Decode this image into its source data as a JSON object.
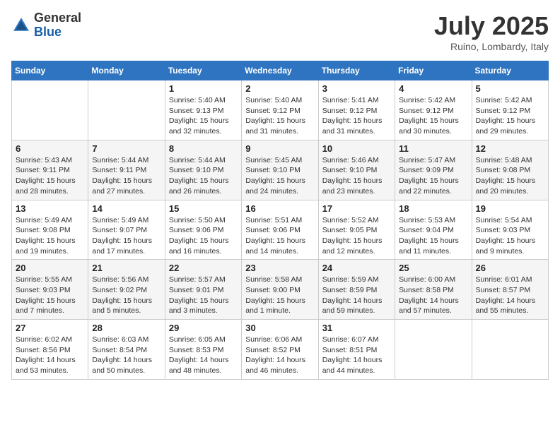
{
  "header": {
    "logo_general": "General",
    "logo_blue": "Blue",
    "month_title": "July 2025",
    "location": "Ruino, Lombardy, Italy"
  },
  "weekdays": [
    "Sunday",
    "Monday",
    "Tuesday",
    "Wednesday",
    "Thursday",
    "Friday",
    "Saturday"
  ],
  "weeks": [
    [
      {
        "day": "",
        "detail": ""
      },
      {
        "day": "",
        "detail": ""
      },
      {
        "day": "1",
        "detail": "Sunrise: 5:40 AM\nSunset: 9:13 PM\nDaylight: 15 hours\nand 32 minutes."
      },
      {
        "day": "2",
        "detail": "Sunrise: 5:40 AM\nSunset: 9:12 PM\nDaylight: 15 hours\nand 31 minutes."
      },
      {
        "day": "3",
        "detail": "Sunrise: 5:41 AM\nSunset: 9:12 PM\nDaylight: 15 hours\nand 31 minutes."
      },
      {
        "day": "4",
        "detail": "Sunrise: 5:42 AM\nSunset: 9:12 PM\nDaylight: 15 hours\nand 30 minutes."
      },
      {
        "day": "5",
        "detail": "Sunrise: 5:42 AM\nSunset: 9:12 PM\nDaylight: 15 hours\nand 29 minutes."
      }
    ],
    [
      {
        "day": "6",
        "detail": "Sunrise: 5:43 AM\nSunset: 9:11 PM\nDaylight: 15 hours\nand 28 minutes."
      },
      {
        "day": "7",
        "detail": "Sunrise: 5:44 AM\nSunset: 9:11 PM\nDaylight: 15 hours\nand 27 minutes."
      },
      {
        "day": "8",
        "detail": "Sunrise: 5:44 AM\nSunset: 9:10 PM\nDaylight: 15 hours\nand 26 minutes."
      },
      {
        "day": "9",
        "detail": "Sunrise: 5:45 AM\nSunset: 9:10 PM\nDaylight: 15 hours\nand 24 minutes."
      },
      {
        "day": "10",
        "detail": "Sunrise: 5:46 AM\nSunset: 9:10 PM\nDaylight: 15 hours\nand 23 minutes."
      },
      {
        "day": "11",
        "detail": "Sunrise: 5:47 AM\nSunset: 9:09 PM\nDaylight: 15 hours\nand 22 minutes."
      },
      {
        "day": "12",
        "detail": "Sunrise: 5:48 AM\nSunset: 9:08 PM\nDaylight: 15 hours\nand 20 minutes."
      }
    ],
    [
      {
        "day": "13",
        "detail": "Sunrise: 5:49 AM\nSunset: 9:08 PM\nDaylight: 15 hours\nand 19 minutes."
      },
      {
        "day": "14",
        "detail": "Sunrise: 5:49 AM\nSunset: 9:07 PM\nDaylight: 15 hours\nand 17 minutes."
      },
      {
        "day": "15",
        "detail": "Sunrise: 5:50 AM\nSunset: 9:06 PM\nDaylight: 15 hours\nand 16 minutes."
      },
      {
        "day": "16",
        "detail": "Sunrise: 5:51 AM\nSunset: 9:06 PM\nDaylight: 15 hours\nand 14 minutes."
      },
      {
        "day": "17",
        "detail": "Sunrise: 5:52 AM\nSunset: 9:05 PM\nDaylight: 15 hours\nand 12 minutes."
      },
      {
        "day": "18",
        "detail": "Sunrise: 5:53 AM\nSunset: 9:04 PM\nDaylight: 15 hours\nand 11 minutes."
      },
      {
        "day": "19",
        "detail": "Sunrise: 5:54 AM\nSunset: 9:03 PM\nDaylight: 15 hours\nand 9 minutes."
      }
    ],
    [
      {
        "day": "20",
        "detail": "Sunrise: 5:55 AM\nSunset: 9:03 PM\nDaylight: 15 hours\nand 7 minutes."
      },
      {
        "day": "21",
        "detail": "Sunrise: 5:56 AM\nSunset: 9:02 PM\nDaylight: 15 hours\nand 5 minutes."
      },
      {
        "day": "22",
        "detail": "Sunrise: 5:57 AM\nSunset: 9:01 PM\nDaylight: 15 hours\nand 3 minutes."
      },
      {
        "day": "23",
        "detail": "Sunrise: 5:58 AM\nSunset: 9:00 PM\nDaylight: 15 hours\nand 1 minute."
      },
      {
        "day": "24",
        "detail": "Sunrise: 5:59 AM\nSunset: 8:59 PM\nDaylight: 14 hours\nand 59 minutes."
      },
      {
        "day": "25",
        "detail": "Sunrise: 6:00 AM\nSunset: 8:58 PM\nDaylight: 14 hours\nand 57 minutes."
      },
      {
        "day": "26",
        "detail": "Sunrise: 6:01 AM\nSunset: 8:57 PM\nDaylight: 14 hours\nand 55 minutes."
      }
    ],
    [
      {
        "day": "27",
        "detail": "Sunrise: 6:02 AM\nSunset: 8:56 PM\nDaylight: 14 hours\nand 53 minutes."
      },
      {
        "day": "28",
        "detail": "Sunrise: 6:03 AM\nSunset: 8:54 PM\nDaylight: 14 hours\nand 50 minutes."
      },
      {
        "day": "29",
        "detail": "Sunrise: 6:05 AM\nSunset: 8:53 PM\nDaylight: 14 hours\nand 48 minutes."
      },
      {
        "day": "30",
        "detail": "Sunrise: 6:06 AM\nSunset: 8:52 PM\nDaylight: 14 hours\nand 46 minutes."
      },
      {
        "day": "31",
        "detail": "Sunrise: 6:07 AM\nSunset: 8:51 PM\nDaylight: 14 hours\nand 44 minutes."
      },
      {
        "day": "",
        "detail": ""
      },
      {
        "day": "",
        "detail": ""
      }
    ]
  ]
}
